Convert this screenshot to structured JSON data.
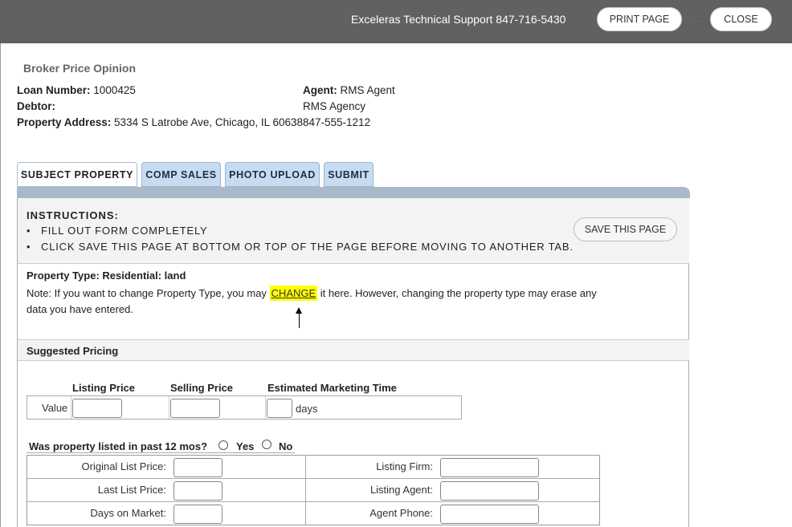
{
  "topbar": {
    "support_text": "Exceleras Technical Support  847-716-5430",
    "print_label": "PRINT PAGE",
    "close_label": "CLOSE",
    "grip": "::"
  },
  "header": {
    "title": "Broker Price Opinion",
    "loan_number_label": "Loan Number:",
    "loan_number": "1000425",
    "debtor_label": "Debtor:",
    "debtor": "",
    "property_address_label": "Property Address:",
    "property_address": "5334 S Latrobe Ave, Chicago, IL 60638",
    "agent_label": "Agent:",
    "agent": "RMS Agent",
    "agency": "RMS Agency",
    "agent_phone": "847-555-1212"
  },
  "tabs": [
    {
      "label": "SUBJECT PROPERTY",
      "active": true
    },
    {
      "label": "COMP SALES",
      "active": false
    },
    {
      "label": "PHOTO UPLOAD",
      "active": false
    },
    {
      "label": "SUBMIT",
      "active": false
    }
  ],
  "instructions": {
    "title": "INSTRUCTIONS:",
    "items": [
      "FILL OUT FORM COMPLETELY",
      "CLICK SAVE THIS PAGE AT BOTTOM OR TOP OF THE PAGE BEFORE MOVING TO ANOTHER TAB."
    ],
    "save_label": "SAVE THIS PAGE"
  },
  "property_type": {
    "text": "Property Type: Residential: land",
    "note_before": "Note: If you want to change Property Type, you may ",
    "change_link": "CHANGE",
    "note_after": " it here. However, changing the property type may erase any data you have entered."
  },
  "suggested_pricing": {
    "title": "Suggested Pricing",
    "col_listing": "Listing Price",
    "col_selling": "Selling Price",
    "col_marketing": "Estimated Marketing Time",
    "row_label": "Value",
    "days_label": "days",
    "listing_value": "",
    "selling_value": "",
    "marketing_value": ""
  },
  "listed": {
    "question": "Was property listed in past 12 mos?",
    "yes_label": "Yes",
    "no_label": "No",
    "rows_left": [
      "Original List Price:",
      "Last List Price:",
      "Days on Market:"
    ],
    "rows_right": [
      "Listing Firm:",
      "Listing Agent:",
      "Agent Phone:"
    ]
  }
}
